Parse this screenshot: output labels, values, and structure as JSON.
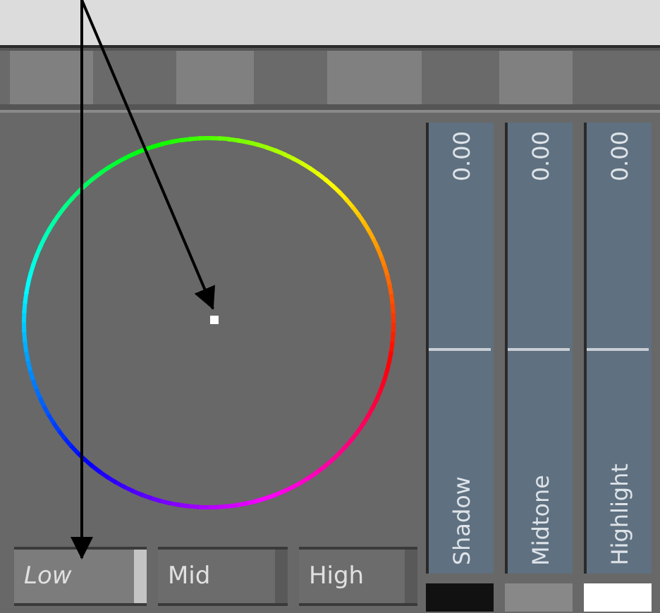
{
  "swatch_strip": [
    {
      "color": "#6a6a6a"
    },
    {
      "color": "#808080"
    },
    {
      "color": "#6a6a6a"
    },
    {
      "color": "#808080"
    },
    {
      "color": "#6a6a6a"
    },
    {
      "color": "#808080"
    },
    {
      "color": "#6a6a6a"
    },
    {
      "color": "#808080"
    },
    {
      "color": "#6a6a6a"
    }
  ],
  "ranges": [
    {
      "label": "Low",
      "selected": true
    },
    {
      "label": "Mid",
      "selected": false
    },
    {
      "label": "High",
      "selected": false
    }
  ],
  "sliders": [
    {
      "label": "Shadow",
      "value": "0.00",
      "level": 0.5,
      "color": "#111111"
    },
    {
      "label": "Midtone",
      "value": "0.00",
      "level": 0.5,
      "color": "#888888"
    },
    {
      "label": "Highlight",
      "value": "0.00",
      "level": 0.5,
      "color": "#ffffff"
    }
  ]
}
